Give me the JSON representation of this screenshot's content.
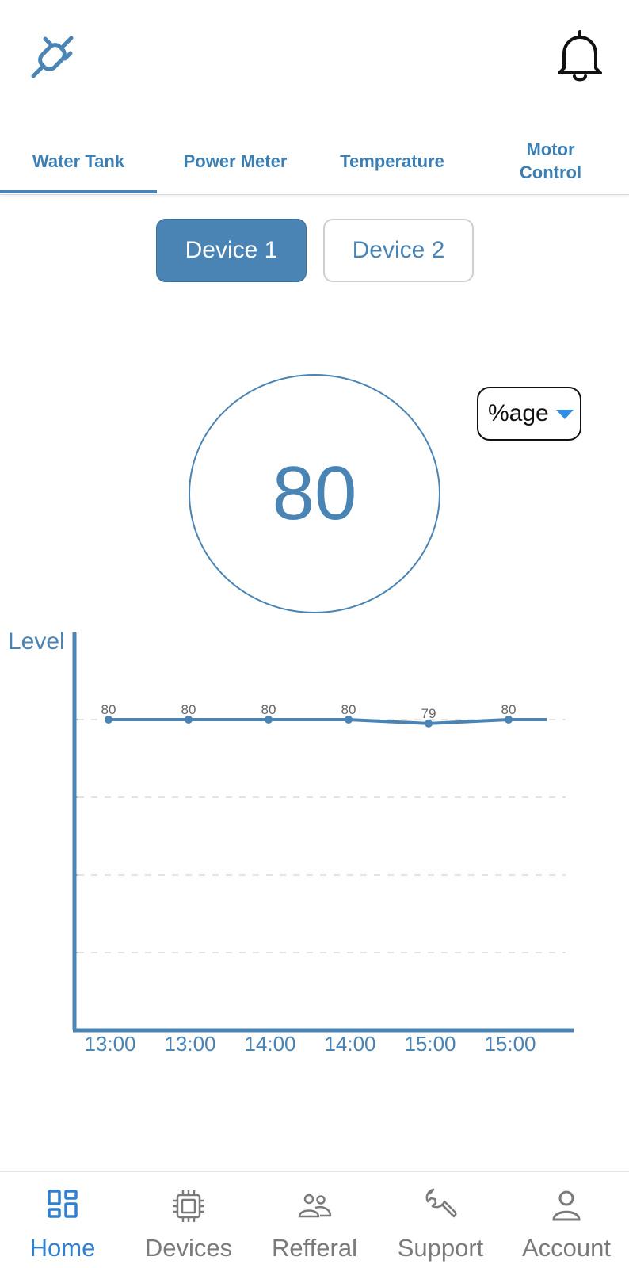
{
  "header": {
    "logo_icon": "plug-icon",
    "notification_icon": "bell-icon"
  },
  "tabs": [
    {
      "label": "Water Tank",
      "active": true
    },
    {
      "label": "Power Meter",
      "active": false
    },
    {
      "label": "Temperature",
      "active": false
    },
    {
      "label": "Motor Control",
      "active": false
    }
  ],
  "devices": [
    {
      "label": "Device 1",
      "selected": true
    },
    {
      "label": "Device 2",
      "selected": false
    }
  ],
  "gauge": {
    "value": "80"
  },
  "unit_select": {
    "value": "%age"
  },
  "chart_data": {
    "type": "line",
    "ylabel": "Level",
    "xlabel": "",
    "categories": [
      "13:00",
      "13:00",
      "14:00",
      "14:00",
      "15:00",
      "15:00"
    ],
    "series": [
      {
        "values": [
          80,
          80,
          80,
          80,
          79,
          80
        ]
      }
    ],
    "data_labels": [
      "80",
      "80",
      "80",
      "80",
      "79",
      "80"
    ],
    "ylim": [
      0,
      100
    ],
    "grid": true,
    "color": "#4a84b4"
  },
  "bottom_nav": [
    {
      "label": "Home",
      "icon": "dashboard-icon",
      "active": true
    },
    {
      "label": "Devices",
      "icon": "chip-icon",
      "active": false
    },
    {
      "label": "Refferal",
      "icon": "people-icon",
      "active": false
    },
    {
      "label": "Support",
      "icon": "wrench-icon",
      "active": false
    },
    {
      "label": "Account",
      "icon": "user-icon",
      "active": false
    }
  ],
  "colors": {
    "primary": "#4a84b4",
    "nav_active": "#2f80d0",
    "nav_inactive": "#7a7a7a"
  }
}
